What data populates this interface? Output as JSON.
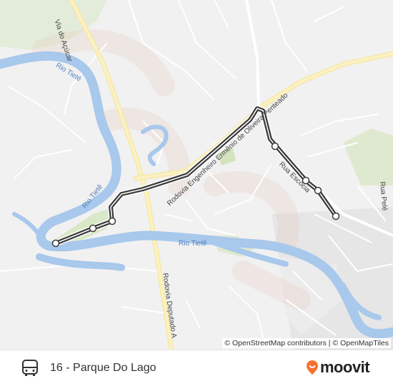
{
  "map": {
    "labels": {
      "river_upper": "Rio Tietê",
      "river_middle": "Rio Tietê",
      "river_lower": "Rio Tietê",
      "road_acucar": "Via do Açúcar",
      "road_rodovia_eng": "Rodovia Engenheiro Ermênio de Oliveira Penteado",
      "road_deputado": "Rodovia Deputado A",
      "road_escocia": "Rua Escócia",
      "road_pele": "Rua Pelé"
    },
    "attribution": "© OpenStreetMap contributors | © OpenMapTiles",
    "route_color": "#3a3a3a",
    "stop_count": 7
  },
  "footer": {
    "route_name": "16 - Parque Do Lago",
    "brand": "moovit",
    "brand_color": "#f7722f",
    "icon": "bus-icon"
  }
}
